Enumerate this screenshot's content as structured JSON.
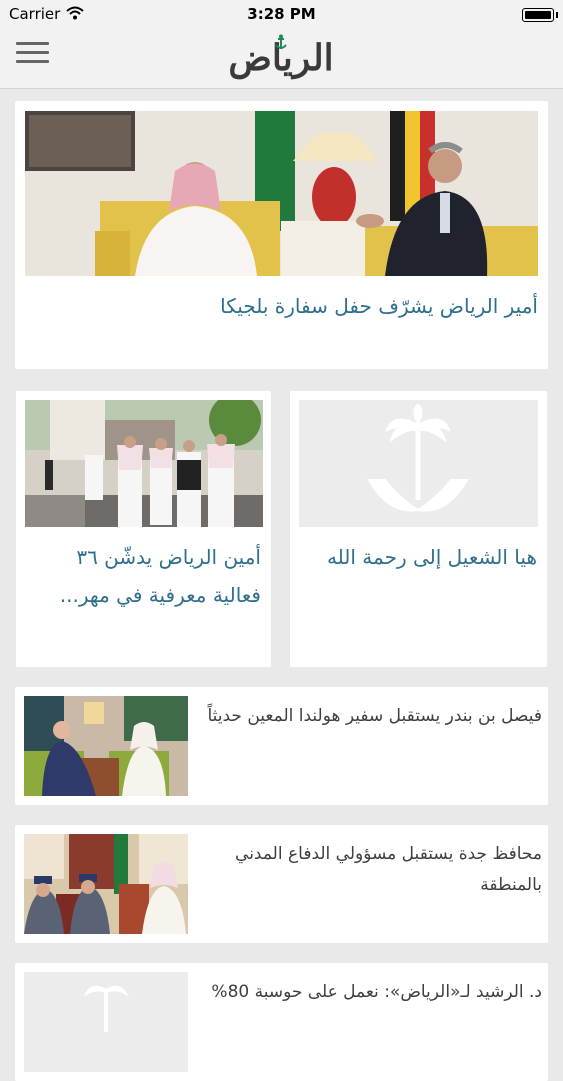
{
  "status_bar": {
    "carrier": "Carrier",
    "time": "3:28 PM"
  },
  "nav": {
    "logo_text": "الرياض",
    "menu_icon": "hamburger-menu-icon"
  },
  "featured": {
    "title": "أمير الرياض يشرّف حفل سفارة بلجيكا"
  },
  "grid": [
    {
      "title": "هيا الشعيل إلى رحمة الله",
      "image": "placeholder-logo"
    },
    {
      "title": "أمين الرياض يدشّن ٣٦ فعالية معرفية في مهر...",
      "image": "photo"
    }
  ],
  "list": [
    {
      "title": "فيصل بن بندر يستقبل سفير هولندا المعين حديثاً"
    },
    {
      "title": "محافظ جدة يستقبل مسؤولي الدفاع المدني بالمنطقة"
    },
    {
      "title": "د. الرشيد لـ«الرياض»: نعمل على حوسبة 80%"
    }
  ],
  "colors": {
    "headline_blue": "#2f6f8e",
    "background": "#e9e9ea",
    "card": "#ffffff"
  }
}
